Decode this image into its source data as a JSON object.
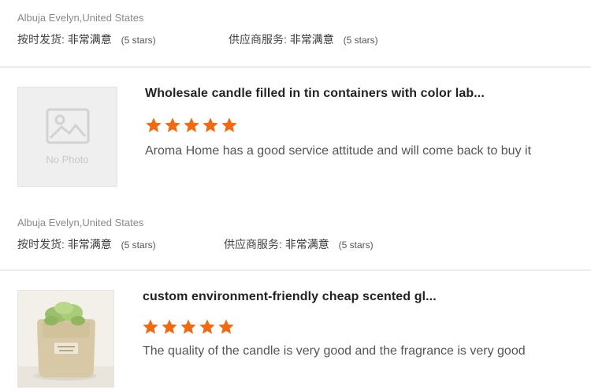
{
  "reviews": [
    {
      "reviewer": "Albuja Evelyn,United States",
      "ship_label": "按时发货:",
      "ship_value": "非常满意",
      "ship_stars": "(5 stars)",
      "service_label": "供应商服务:",
      "service_value": "非常满意",
      "service_stars": "(5 stars)"
    },
    {
      "product_title": "Wholesale candle filled in tin containers with color lab...",
      "thumb_label": "No Photo",
      "rating": 5,
      "rating_max": 5,
      "comment": "Aroma Home has a good service attitude and will come back to buy it",
      "reviewer": "Albuja Evelyn,United States",
      "ship_label": "按时发货:",
      "ship_value": "非常满意",
      "ship_stars": "(5 stars)",
      "service_label": "供应商服务:",
      "service_value": "非常满意",
      "service_stars": "(5 stars)"
    },
    {
      "product_title": "custom environment-friendly cheap scented gl...",
      "rating": 5,
      "rating_max": 5,
      "comment": "The quality of the candle is very good and the fragrance is very good"
    }
  ],
  "colors": {
    "star": "#f26a10",
    "divider": "#ececec",
    "placeholder_bg": "#efefef"
  },
  "icons": {
    "star": "star-icon",
    "placeholder": "image-placeholder-icon"
  }
}
